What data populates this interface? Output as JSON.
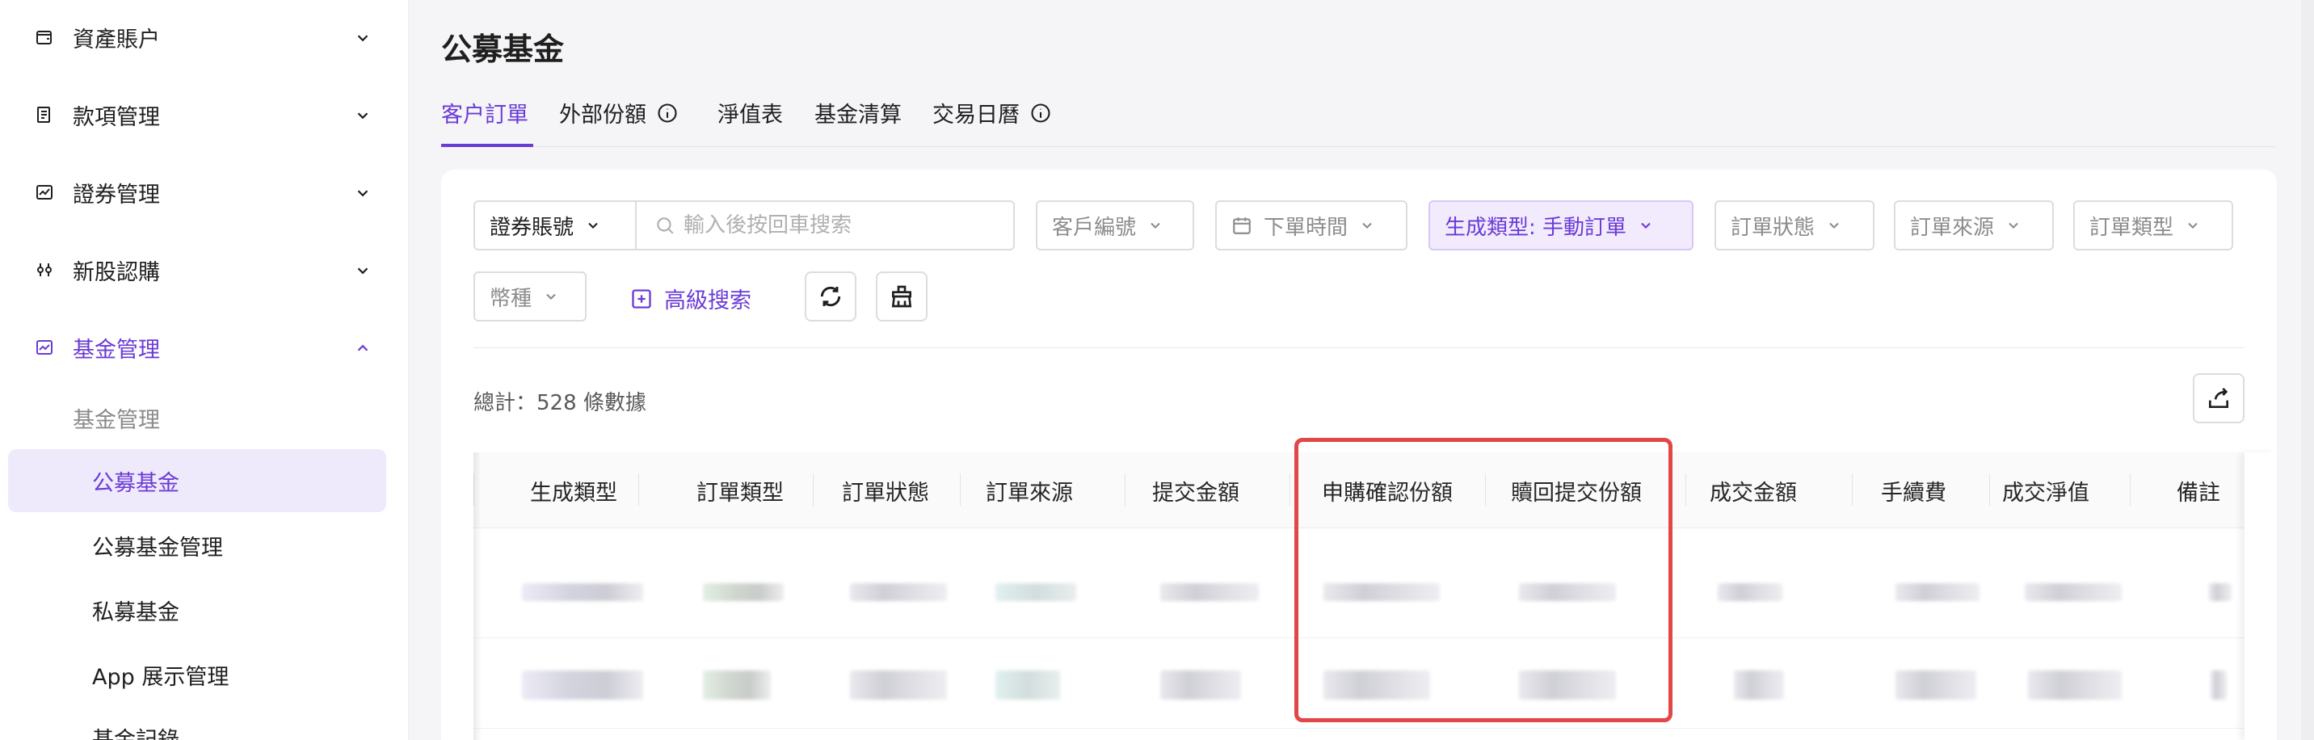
{
  "sidebar": {
    "items": [
      {
        "label": "資產賬户",
        "icon": "wallet-icon"
      },
      {
        "label": "款項管理",
        "icon": "document-list-icon"
      },
      {
        "label": "證券管理",
        "icon": "stock-chart-icon"
      },
      {
        "label": "新股認購",
        "icon": "sliders-icon"
      },
      {
        "label": "基金管理",
        "icon": "trend-chart-icon"
      }
    ],
    "fund_submenu": {
      "group_label": "基金管理",
      "items": [
        "公募基金",
        "公募基金管理",
        "私募基金",
        "App 展示管理",
        "基金記錄"
      ]
    }
  },
  "page": {
    "title": "公募基金",
    "tabs": [
      {
        "label": "客户訂單",
        "active": true,
        "info": false
      },
      {
        "label": "外部份額",
        "active": false,
        "info": true
      },
      {
        "label": "淨值表",
        "active": false,
        "info": false
      },
      {
        "label": "基金清算",
        "active": false,
        "info": false
      },
      {
        "label": "交易日曆",
        "active": false,
        "info": true
      }
    ]
  },
  "filters": {
    "account_select": "證券賬號",
    "search_placeholder": "輸入後按回車搜索",
    "customer_no": "客戶編號",
    "order_time": "下單時間",
    "gen_type": "生成類型: 手動訂單",
    "order_status": "訂單狀態",
    "order_source": "訂單來源",
    "order_type": "訂單類型",
    "currency": "幣種",
    "advanced_search": "高級搜索"
  },
  "summary": {
    "total": "總計：528 條數據"
  },
  "table": {
    "columns": [
      "生成類型",
      "訂單類型",
      "訂單狀態",
      "訂單來源",
      "提交金額",
      "申購確認份額",
      "贖回提交份額",
      "成交金額",
      "手續費",
      "成交淨值",
      "備註"
    ]
  },
  "colors": {
    "accent": "#6a3bd6",
    "highlight": "#e24646"
  }
}
